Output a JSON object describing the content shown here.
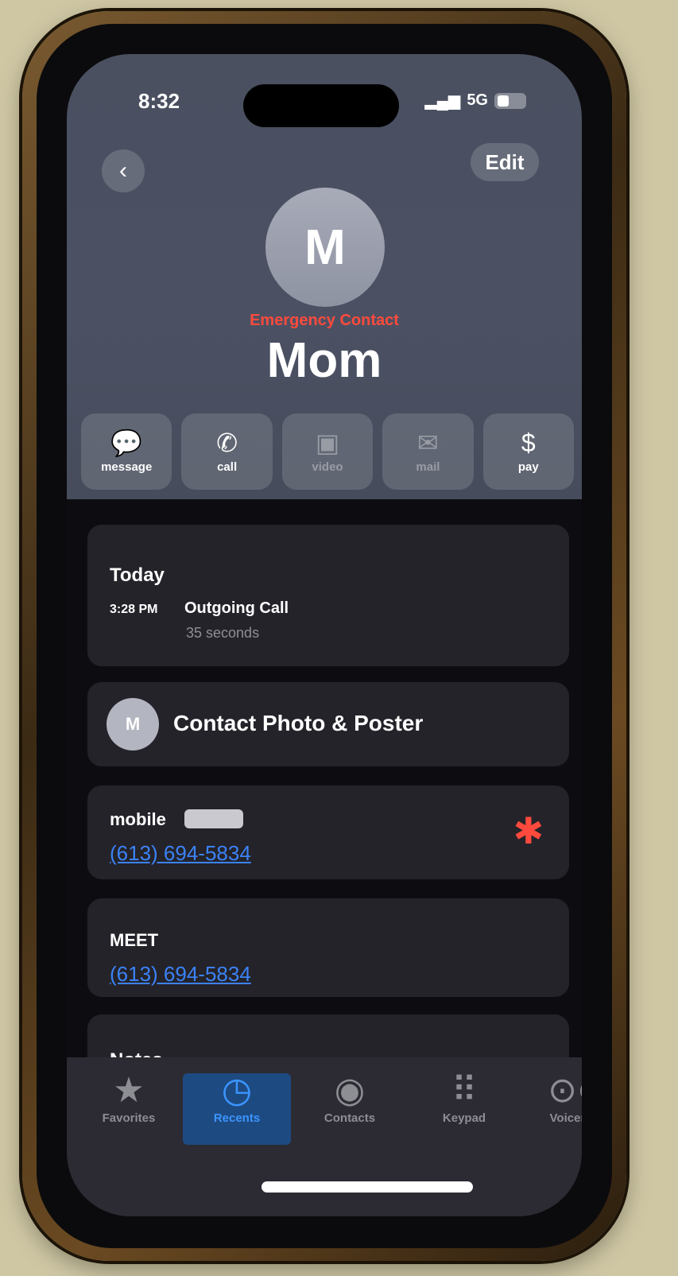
{
  "status": {
    "time": "8:32",
    "network": "5G"
  },
  "header": {
    "back_icon": "chevron-left-icon",
    "edit_label": "Edit"
  },
  "contact": {
    "initial": "M",
    "emergency_label": "Emergency Contact",
    "name": "Mom"
  },
  "actions": [
    {
      "label": "message",
      "icon": "message-bubble-icon",
      "enabled": true
    },
    {
      "label": "call",
      "icon": "phone-icon",
      "enabled": true
    },
    {
      "label": "video",
      "icon": "video-icon",
      "enabled": false
    },
    {
      "label": "mail",
      "icon": "mail-icon",
      "enabled": false
    },
    {
      "label": "pay",
      "icon": "dollar-icon",
      "enabled": true
    }
  ],
  "recents": {
    "day": "Today",
    "time": "3:28 PM",
    "type": "Outgoing Call",
    "duration": "35 seconds"
  },
  "photo_poster": {
    "label": "Contact Photo & Poster",
    "initial": "M"
  },
  "phones": [
    {
      "label": "mobile",
      "number": "(613) 694-5834",
      "emergency_icon": "medical-star-icon"
    },
    {
      "label": "MEET",
      "number": "(613) 694-5834"
    }
  ],
  "notes": {
    "label": "Notes"
  },
  "tabs": [
    {
      "label": "Favorites",
      "icon": "star-icon",
      "active": false
    },
    {
      "label": "Recents",
      "icon": "clock-icon",
      "active": true
    },
    {
      "label": "Contacts",
      "icon": "person-circle-icon",
      "active": false
    },
    {
      "label": "Keypad",
      "icon": "keypad-icon",
      "active": false
    },
    {
      "label": "Voicemail",
      "icon": "voicemail-icon",
      "active": false
    }
  ],
  "colors": {
    "accent": "#3b82f6",
    "emergency": "#ff4a3d",
    "header_bg": "#4a5060",
    "card_bg": "#24232a"
  }
}
